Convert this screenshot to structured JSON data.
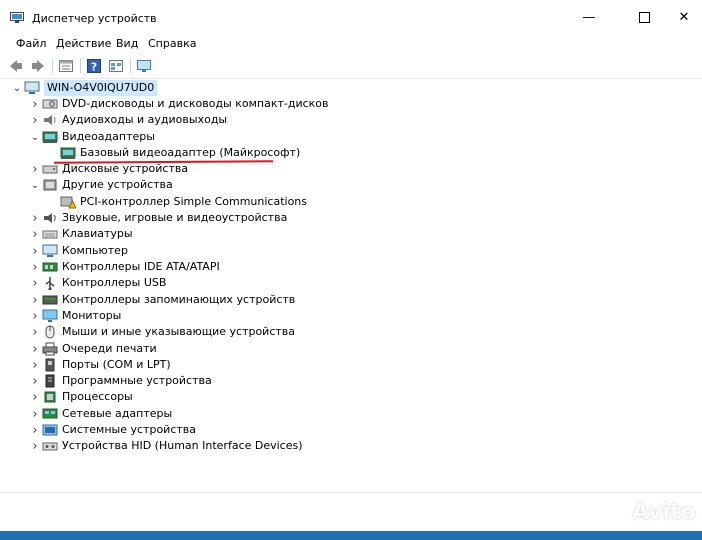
{
  "window": {
    "title": "Диспетчер устройств",
    "minimize_icon": "minimize-icon",
    "maximize_icon": "maximize-icon",
    "close_icon": "close-icon"
  },
  "menu": [
    "Файл",
    "Действие",
    "Вид",
    "Справка"
  ],
  "toolbar": [
    "back-icon",
    "forward-icon",
    "properties-icon",
    "help-icon",
    "view-icon",
    "monitor-icon"
  ],
  "tree": {
    "root": "WIN-O4V0IQU7UD0",
    "items": [
      {
        "label": "DVD-дисководы и дисководы компакт-дисков",
        "icon": "dvd-icon",
        "expanded": false
      },
      {
        "label": "Аудиовходы и аудиовыходы",
        "icon": "audio-icon",
        "expanded": false
      },
      {
        "label": "Видеоадаптеры",
        "icon": "display-adapter-icon",
        "expanded": true,
        "children": [
          {
            "label": "Базовый видеоадаптер (Майкрософт)",
            "icon": "display-adapter-icon"
          }
        ]
      },
      {
        "label": "Дисковые устройства",
        "icon": "disk-icon",
        "expanded": false
      },
      {
        "label": "Другие устройства",
        "icon": "other-devices-icon",
        "expanded": true,
        "children": [
          {
            "label": "PCI-контроллер Simple Communications",
            "icon": "warning-icon"
          }
        ]
      },
      {
        "label": "Звуковые, игровые и видеоустройства",
        "icon": "sound-icon",
        "expanded": false
      },
      {
        "label": "Клавиатуры",
        "icon": "keyboard-icon",
        "expanded": false
      },
      {
        "label": "Компьютер",
        "icon": "computer-icon",
        "expanded": false
      },
      {
        "label": "Контроллеры IDE ATA/ATAPI",
        "icon": "ide-icon",
        "expanded": false
      },
      {
        "label": "Контроллеры USB",
        "icon": "usb-icon",
        "expanded": false
      },
      {
        "label": "Контроллеры запоминающих устройств",
        "icon": "storage-icon",
        "expanded": false
      },
      {
        "label": "Мониторы",
        "icon": "monitor-icon",
        "expanded": false
      },
      {
        "label": "Мыши и иные указывающие устройства",
        "icon": "mouse-icon",
        "expanded": false
      },
      {
        "label": "Очереди печати",
        "icon": "printer-icon",
        "expanded": false
      },
      {
        "label": "Порты (COM и LPT)",
        "icon": "port-icon",
        "expanded": false
      },
      {
        "label": "Программные устройства",
        "icon": "software-device-icon",
        "expanded": false
      },
      {
        "label": "Процессоры",
        "icon": "processor-icon",
        "expanded": false
      },
      {
        "label": "Сетевые адаптеры",
        "icon": "network-icon",
        "expanded": false
      },
      {
        "label": "Системные устройства",
        "icon": "system-icon",
        "expanded": false
      },
      {
        "label": "Устройства HID (Human Interface Devices)",
        "icon": "hid-icon",
        "expanded": false
      }
    ]
  },
  "watermark": "Avito",
  "colors": {
    "selection": "#cce8ff",
    "annotation": "#e0141e",
    "desktop": "#1e6fb8"
  }
}
